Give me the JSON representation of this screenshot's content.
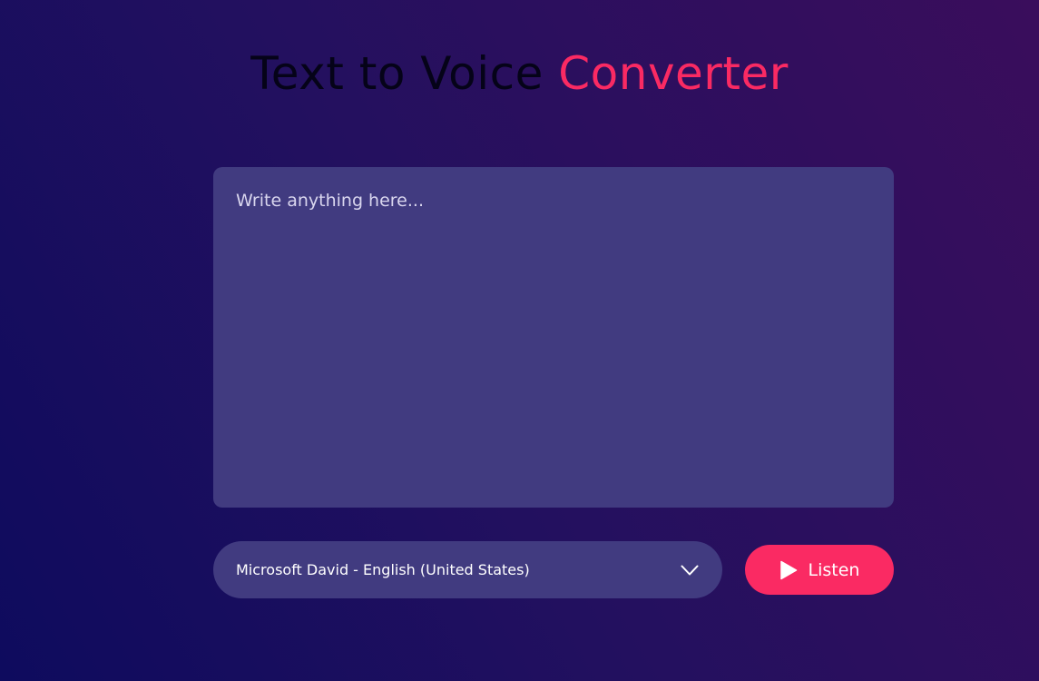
{
  "header": {
    "title_part1": "Text to Voice ",
    "title_part2": "Converter"
  },
  "editor": {
    "placeholder": "Write anything here...",
    "value": ""
  },
  "voice_select": {
    "selected": "Microsoft David - English (United States)",
    "icon": "chevron-down-icon"
  },
  "listen_button": {
    "label": "Listen",
    "icon": "play-icon"
  },
  "colors": {
    "accent": "#fa2a63",
    "panel": "#413b80",
    "background_start": "#0e0b5e",
    "background_end": "#3a0d5c"
  }
}
